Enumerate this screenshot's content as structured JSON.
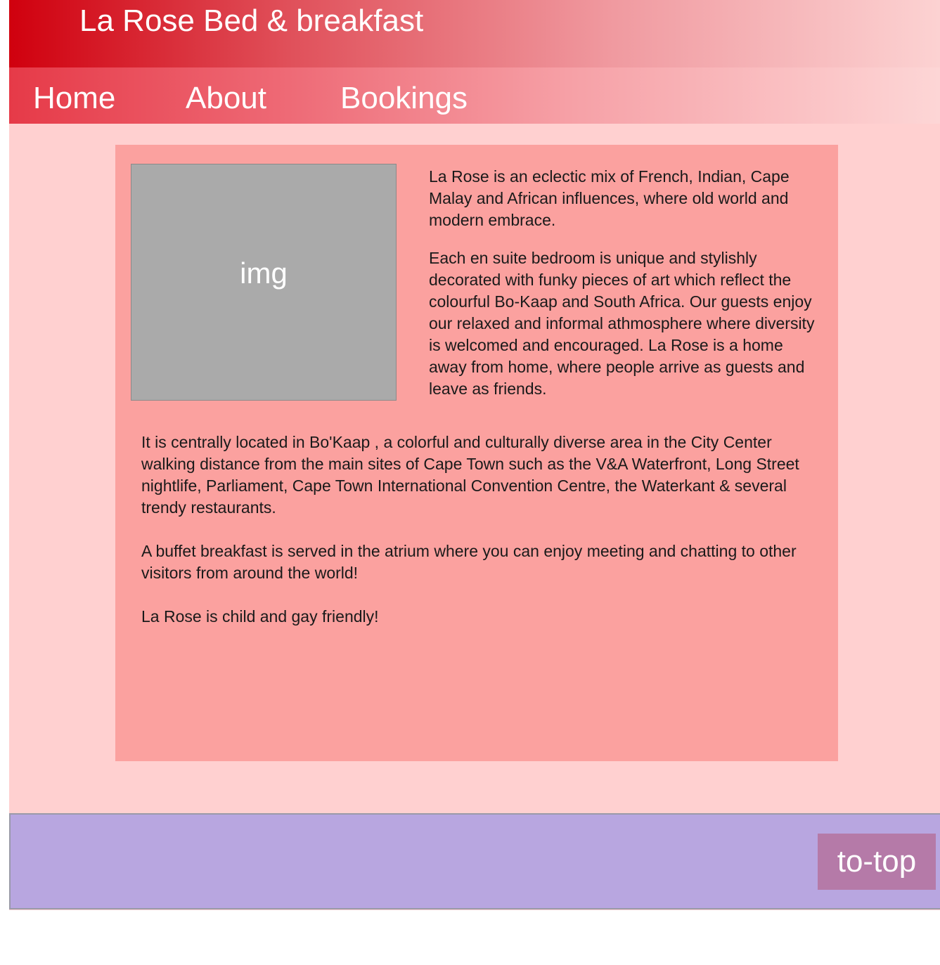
{
  "header": {
    "title": "La Rose Bed & breakfast"
  },
  "nav": {
    "items": [
      {
        "label": "Home"
      },
      {
        "label": "About"
      },
      {
        "label": "Bookings"
      }
    ]
  },
  "main": {
    "image_placeholder_label": "img",
    "side_paragraphs": [
      "La Rose is an eclectic mix of French, Indian, Cape Malay and African influences, where old world and modern embrace.",
      "Each en suite bedroom is unique and stylishly decorated with funky pieces of art which reflect the colourful Bo-Kaap and South Africa. Our guests enjoy our  relaxed and informal athmosphere where diversity is welcomed and encouraged. La Rose is a home away from home, where people arrive as guests and leave as friends."
    ],
    "bottom_paragraphs": [
      "It is centrally located in Bo'Kaap , a colorful and culturally diverse area in the City Center walking distance from the main sites of Cape Town such as the V&A Waterfront, Long Street nightlife, Parliament, Cape Town International Convention Centre, the Waterkant & several trendy restaurants.",
      "A buffet breakfast is served in the atrium where you can enjoy meeting and chatting to other visitors from around the world!",
      "La Rose is child and gay friendly!"
    ]
  },
  "footer": {
    "to_top_label": "to-top"
  },
  "colors": {
    "page_background": "#ffd0d0",
    "content_background": "#fba19f",
    "footer_background": "#b8a6e0",
    "to_top_background": "#b57aa8",
    "header_red": "#d0000e"
  }
}
